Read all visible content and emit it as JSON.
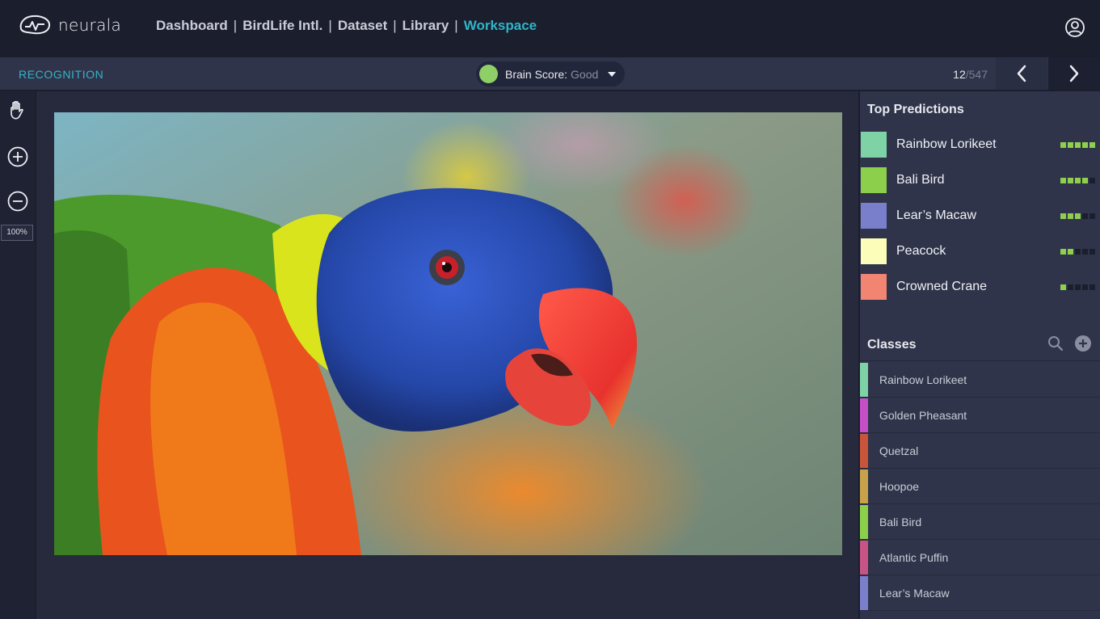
{
  "app": {
    "logo_text": "neurala"
  },
  "breadcrumb": {
    "items": [
      "Dashboard",
      "BirdLife Intl.",
      "Dataset",
      "Library"
    ],
    "active": "Workspace",
    "separator": "|"
  },
  "subbar": {
    "mode_label": "RECOGNITION",
    "brain_label": "Brain Score:",
    "brain_value": "Good",
    "brain_color": "#8ecf67",
    "counter_current": "12",
    "counter_total": "/547"
  },
  "tools": {
    "zoom_level": "100%",
    "icons": [
      "hand-icon",
      "zoom-in-icon",
      "zoom-out-icon"
    ]
  },
  "image": {
    "subject_description": "Close-up photo of a rainbow lorikeet"
  },
  "top_predictions": {
    "title": "Top Predictions",
    "items": [
      {
        "label": "Rainbow Lorikeet",
        "color": "#7dd3a6",
        "score_of_5": 5
      },
      {
        "label": "Bali Bird",
        "color": "#8bcf4a",
        "score_of_5": 4
      },
      {
        "label": "Lear’s Macaw",
        "color": "#7a7fcb",
        "score_of_5": 3
      },
      {
        "label": "Peacock",
        "color": "#fbfdb8",
        "score_of_5": 2
      },
      {
        "label": "Crowned Crane",
        "color": "#f28472",
        "score_of_5": 1
      }
    ]
  },
  "classes": {
    "title": "Classes",
    "icons": [
      "search-icon",
      "add-icon"
    ],
    "items": [
      {
        "label": "Rainbow Lorikeet",
        "color": "#7dd3a6"
      },
      {
        "label": "Golden Pheasant",
        "color": "#c44fc7"
      },
      {
        "label": "Quetzal",
        "color": "#c8553a"
      },
      {
        "label": "Hoopoe",
        "color": "#c7a24a"
      },
      {
        "label": "Bali Bird",
        "color": "#8bcf4a"
      },
      {
        "label": "Atlantic Puffin",
        "color": "#c75485"
      },
      {
        "label": "Lear’s Macaw",
        "color": "#7a7fcb"
      }
    ]
  },
  "colors": {
    "accent": "#2fb4c8",
    "topbar": "#1b1e2d",
    "panel": "#30344a",
    "score_on": "#8ecf4e"
  }
}
